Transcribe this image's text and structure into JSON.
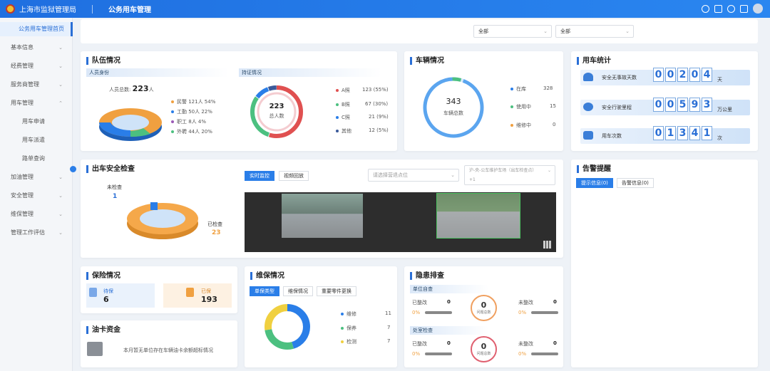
{
  "app": {
    "org": "上海市监狱管理局",
    "module": "公务用车管理"
  },
  "sidebar": {
    "items": [
      {
        "label": "公务用车管理首页",
        "active": true
      },
      {
        "label": "基本信息",
        "chevron": true
      },
      {
        "label": "经费管理",
        "chevron": true
      },
      {
        "label": "服务商管理",
        "chevron": true
      },
      {
        "label": "用车管理",
        "chevron": true,
        "expanded": true
      },
      {
        "label": "用车申请",
        "sub": true
      },
      {
        "label": "用车派遣",
        "sub": true
      },
      {
        "label": "路单查询",
        "sub": true
      },
      {
        "label": "加油管理",
        "chevron": true
      },
      {
        "label": "安全管理",
        "chevron": true
      },
      {
        "label": "维保管理",
        "chevron": true
      },
      {
        "label": "管理工作评估",
        "chevron": true
      }
    ]
  },
  "filters": {
    "select1": "全部",
    "select2": "全部"
  },
  "team": {
    "title": "队伍情况",
    "identity_head": "人员身份",
    "total_label": "人员总数:",
    "total_value": "223",
    "total_unit": "人",
    "identities": [
      {
        "label": "民警 121人 54%",
        "color": "#f0a040"
      },
      {
        "label": "工勤 50人 22%",
        "color": "#2a7ee8"
      },
      {
        "label": "职工 8人 4%",
        "color": "#9b59b6"
      },
      {
        "label": "外聘 44人 20%",
        "color": "#4cc080"
      }
    ],
    "license_head": "持证情况",
    "ring_value": "223",
    "ring_label": "总人数",
    "licenses": [
      {
        "name": "A照",
        "value": "123 (55%)",
        "color": "#e05050"
      },
      {
        "name": "B照",
        "value": "67 (30%)",
        "color": "#4cc080"
      },
      {
        "name": "C照",
        "value": "21 (9%)",
        "color": "#2a7ee8"
      },
      {
        "name": "其他",
        "value": "12 (5%)",
        "color": "#3a5a9a"
      }
    ]
  },
  "vehicle": {
    "title": "车辆情况",
    "total": "343",
    "total_label": "车辆总数",
    "status": [
      {
        "name": "在库",
        "value": "328",
        "color": "#2a7ee8"
      },
      {
        "name": "使用中",
        "value": "15",
        "color": "#4cc080"
      },
      {
        "name": "维修中",
        "value": "0",
        "color": "#f0a040"
      }
    ]
  },
  "usage": {
    "title": "用车统计",
    "rows": [
      {
        "label": "安全无事故天数",
        "digits": [
          "0",
          "0",
          "2",
          "0",
          "4"
        ],
        "unit": "天"
      },
      {
        "label": "安全行驶里程",
        "digits": [
          "0",
          "0",
          "5",
          "9",
          "3"
        ],
        "unit": "万公里"
      },
      {
        "label": "用车次数",
        "digits": [
          "0",
          "1",
          "3",
          "4",
          "1"
        ],
        "unit": "次"
      }
    ]
  },
  "inspection": {
    "title": "出车安全检查",
    "unchecked_label": "未检查",
    "unchecked_value": "1",
    "checked_label": "已检查",
    "checked_value": "23",
    "tab_live": "实时监控",
    "tab_playback": "视频回放",
    "point_placeholder": "请选择营退点位",
    "cam_select": "沪-央-公车维护车场（出车检查点）",
    "cam_extra": "+1"
  },
  "alerts": {
    "title": "告警提醒",
    "tab_info": "提示信息(0)",
    "tab_alarm": "告警信息(0)"
  },
  "insurance": {
    "title": "保险情况",
    "insured_label": "待保",
    "insured_value": "6",
    "done_label": "已保",
    "done_value": "193"
  },
  "fuel": {
    "title": "油卡资金",
    "message": "本月暂无单位存在车辆油卡余额超标情况"
  },
  "maintenance": {
    "title": "维保情况",
    "tabs": [
      "单保类型",
      "维保情况",
      "重要零件更换"
    ],
    "items": [
      {
        "name": "维修",
        "value": "11",
        "color": "#2a7ee8"
      },
      {
        "name": "保养",
        "value": "7",
        "color": "#4cc080"
      },
      {
        "name": "检测",
        "value": "7",
        "color": "#f0d040"
      }
    ]
  },
  "hazard": {
    "title": "隐患排查",
    "sections": [
      {
        "head": "单位自查",
        "done_label": "已整改",
        "done_value": "0",
        "done_pct": "0%",
        "center_value": "0",
        "center_label": "问题总数",
        "todo_label": "未整改",
        "todo_value": "0",
        "todo_pct": "0%"
      },
      {
        "head": "处室检查",
        "done_label": "已整改",
        "done_value": "0",
        "done_pct": "0%",
        "center_value": "0",
        "center_label": "问题总数",
        "todo_label": "未整改",
        "todo_value": "0",
        "todo_pct": "0%"
      }
    ]
  }
}
